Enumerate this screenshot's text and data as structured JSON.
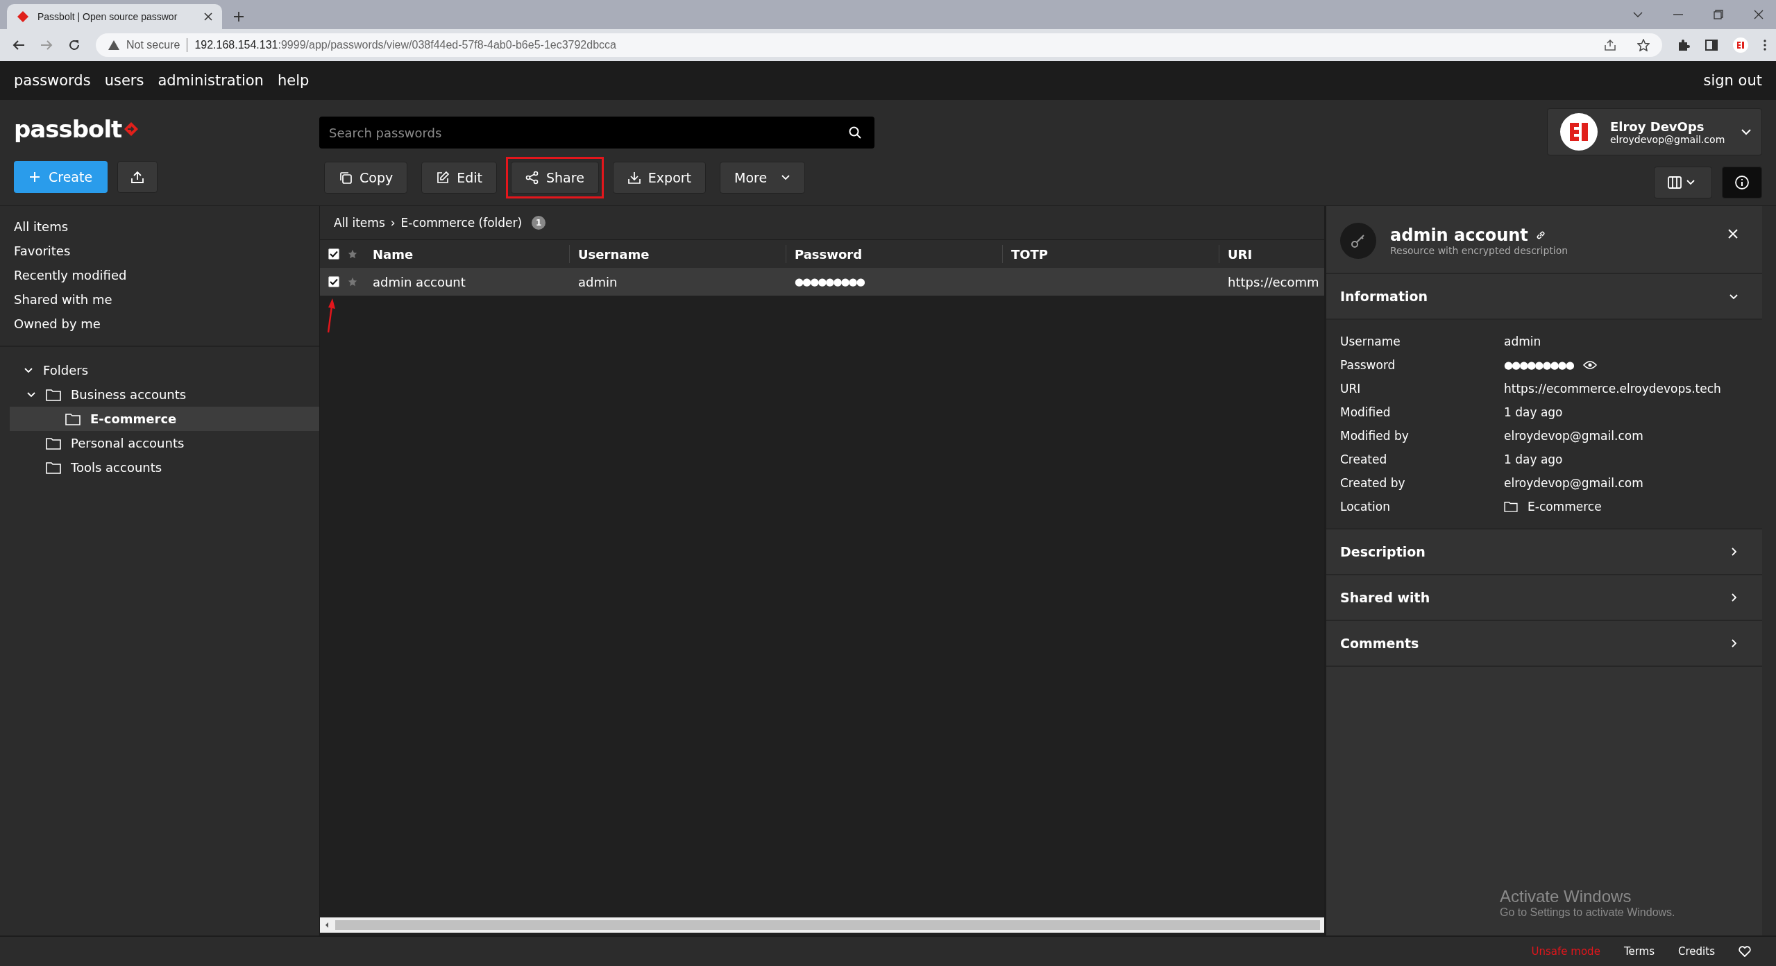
{
  "browser": {
    "tab_title": "Passbolt | Open source passwor",
    "security": "Not secure",
    "url_host": "192.168.154.131",
    "url_rest": ":9999/app/passwords/view/038f44ed-57f8-4ab0-b6e5-1ec3792dbcca"
  },
  "nav": {
    "items": [
      "passwords",
      "users",
      "administration",
      "help"
    ],
    "sign_out": "sign out"
  },
  "logo": "passbolt",
  "search": {
    "placeholder": "Search passwords"
  },
  "user": {
    "name": "Elroy DevOps",
    "email": "elroydevop@gmail.com"
  },
  "create": "Create",
  "toolbar": [
    {
      "label": "Copy",
      "kind": "copy",
      "highlighted": false
    },
    {
      "label": "Edit",
      "kind": "edit",
      "highlighted": false
    },
    {
      "label": "Share",
      "kind": "share",
      "highlighted": true
    },
    {
      "label": "Export",
      "kind": "export",
      "highlighted": false
    },
    {
      "label": "More",
      "kind": "more",
      "highlighted": false
    }
  ],
  "filters": [
    {
      "label": "All items",
      "selected": false
    },
    {
      "label": "Favorites",
      "selected": false
    },
    {
      "label": "Recently modified",
      "selected": false
    },
    {
      "label": "Shared with me",
      "selected": false
    },
    {
      "label": "Owned by me",
      "selected": false
    }
  ],
  "folders": {
    "title": "Folders",
    "expanded": true,
    "items": [
      {
        "name": "Business accounts",
        "expanded": true,
        "selected": false,
        "children": [
          {
            "name": "E-commerce",
            "selected": true
          }
        ]
      },
      {
        "name": "Personal accounts",
        "selected": false
      },
      {
        "name": "Tools accounts",
        "selected": false
      }
    ]
  },
  "breadcrumb": {
    "root": "All items",
    "separator": "›",
    "current": "E-commerce (folder)",
    "count": "1"
  },
  "table": {
    "columns": [
      "Name",
      "Username",
      "Password",
      "TOTP",
      "URI"
    ],
    "all_checked": true,
    "rows": [
      {
        "checked": true,
        "favorite": false,
        "name": "admin account",
        "username": "admin",
        "password": "●●●●●●●●●",
        "uri": "https://ecomm"
      }
    ]
  },
  "details": {
    "title": "admin account",
    "subtitle": "Resource with encrypted description",
    "sections": [
      {
        "title": "Information",
        "expanded": true,
        "fields": [
          {
            "kind": "text",
            "label": "Username",
            "value": "admin"
          },
          {
            "kind": "password",
            "label": "Password",
            "value": "●●●●●●●●●"
          },
          {
            "kind": "text",
            "label": "URI",
            "value": "https://ecommerce.elroydevops.tech"
          },
          {
            "kind": "text",
            "label": "Modified",
            "value": "1 day ago"
          },
          {
            "kind": "text",
            "label": "Modified by",
            "value": "elroydevop@gmail.com"
          },
          {
            "kind": "text",
            "label": "Created",
            "value": "1 day ago"
          },
          {
            "kind": "text",
            "label": "Created by",
            "value": "elroydevop@gmail.com"
          },
          {
            "kind": "folder",
            "label": "Location",
            "value": "E-commerce"
          }
        ]
      },
      {
        "title": "Description",
        "expanded": false
      },
      {
        "title": "Shared with",
        "expanded": false
      },
      {
        "title": "Comments",
        "expanded": false
      }
    ]
  },
  "os_notice": {
    "title": "Activate Windows",
    "text": "Go to Settings to activate Windows."
  },
  "footer": {
    "warning": "Unsafe mode",
    "links": [
      "Terms",
      "Credits"
    ]
  }
}
